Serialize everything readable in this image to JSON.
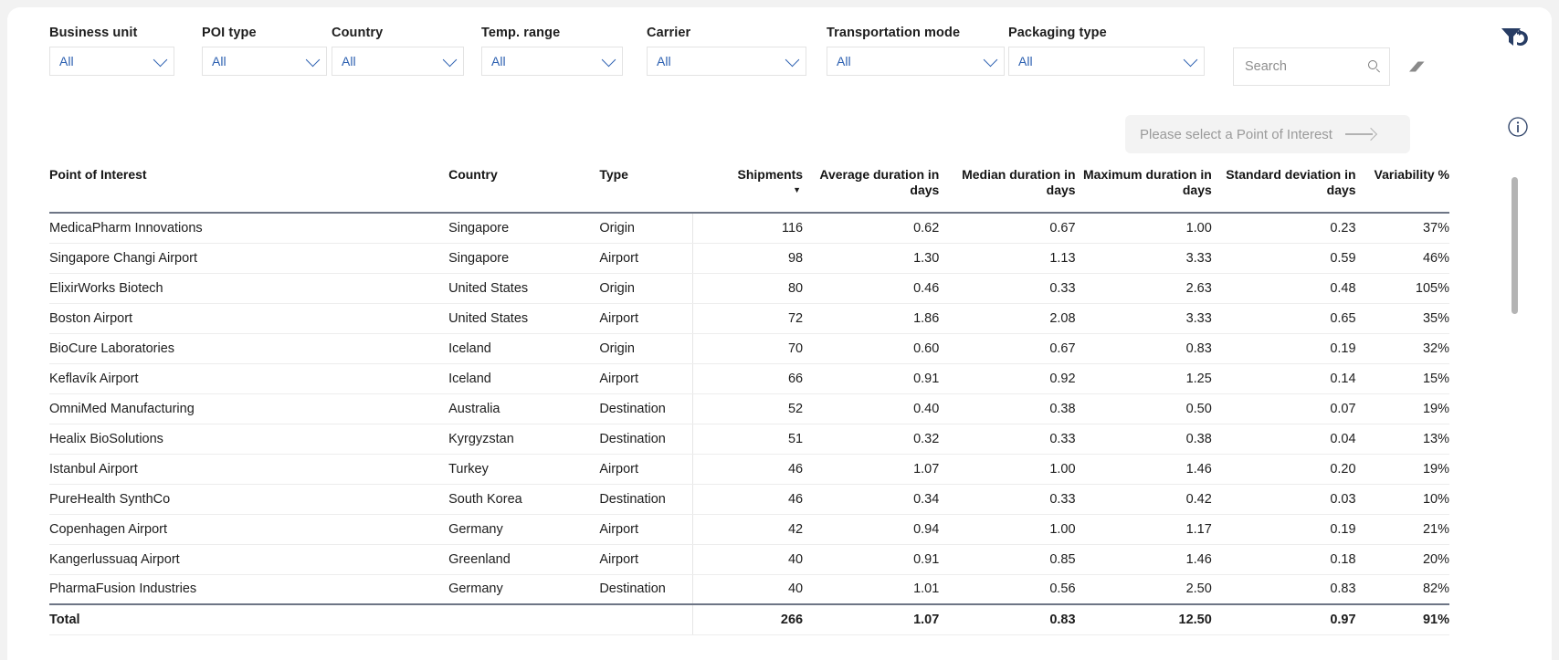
{
  "filters": [
    {
      "label": "Business unit",
      "value": "All",
      "name": "business-unit"
    },
    {
      "label": "POI type",
      "value": "All",
      "name": "poi-type"
    },
    {
      "label": "Country",
      "value": "All",
      "name": "country"
    },
    {
      "label": "Temp. range",
      "value": "All",
      "name": "temp-range"
    },
    {
      "label": "Carrier",
      "value": "All",
      "name": "carrier"
    },
    {
      "label": "Transportation mode",
      "value": "All",
      "name": "transportation-mode"
    },
    {
      "label": "Packaging type",
      "value": "All",
      "name": "packaging-type"
    }
  ],
  "search": {
    "value": "",
    "placeholder": "Search"
  },
  "poi_prompt": {
    "text": "Please select a Point of Interest"
  },
  "table": {
    "columns": [
      "Point of Interest",
      "Country",
      "Type",
      "Shipments",
      "Average duration in days",
      "Median duration in days",
      "Maximum duration in days",
      "Standard deviation in days",
      "Variability %"
    ],
    "sorted_column": "Shipments",
    "sort_direction": "desc",
    "sort_glyph": "▼",
    "rows": [
      {
        "poi": "MedicaPharm Innovations",
        "country": "Singapore",
        "type": "Origin",
        "shipments": "116",
        "avg": "0.62",
        "median": "0.67",
        "max": "1.00",
        "std": "0.23",
        "variability": "37%"
      },
      {
        "poi": "Singapore Changi Airport",
        "country": "Singapore",
        "type": "Airport",
        "shipments": "98",
        "avg": "1.30",
        "median": "1.13",
        "max": "3.33",
        "std": "0.59",
        "variability": "46%"
      },
      {
        "poi": "ElixirWorks Biotech",
        "country": "United States",
        "type": "Origin",
        "shipments": "80",
        "avg": "0.46",
        "median": "0.33",
        "max": "2.63",
        "std": "0.48",
        "variability": "105%"
      },
      {
        "poi": "Boston Airport",
        "country": "United States",
        "type": "Airport",
        "shipments": "72",
        "avg": "1.86",
        "median": "2.08",
        "max": "3.33",
        "std": "0.65",
        "variability": "35%"
      },
      {
        "poi": "BioCure Laboratories",
        "country": "Iceland",
        "type": "Origin",
        "shipments": "70",
        "avg": "0.60",
        "median": "0.67",
        "max": "0.83",
        "std": "0.19",
        "variability": "32%"
      },
      {
        "poi": "Keflavík Airport",
        "country": "Iceland",
        "type": "Airport",
        "shipments": "66",
        "avg": "0.91",
        "median": "0.92",
        "max": "1.25",
        "std": "0.14",
        "variability": "15%"
      },
      {
        "poi": "OmniMed Manufacturing",
        "country": "Australia",
        "type": "Destination",
        "shipments": "52",
        "avg": "0.40",
        "median": "0.38",
        "max": "0.50",
        "std": "0.07",
        "variability": "19%"
      },
      {
        "poi": "Healix BioSolutions",
        "country": "Kyrgyzstan",
        "type": "Destination",
        "shipments": "51",
        "avg": "0.32",
        "median": "0.33",
        "max": "0.38",
        "std": "0.04",
        "variability": "13%"
      },
      {
        "poi": "Istanbul Airport",
        "country": "Turkey",
        "type": "Airport",
        "shipments": "46",
        "avg": "1.07",
        "median": "1.00",
        "max": "1.46",
        "std": "0.20",
        "variability": "19%"
      },
      {
        "poi": "PureHealth SynthCo",
        "country": "South Korea",
        "type": "Destination",
        "shipments": "46",
        "avg": "0.34",
        "median": "0.33",
        "max": "0.42",
        "std": "0.03",
        "variability": "10%"
      },
      {
        "poi": "Copenhagen Airport",
        "country": "Germany",
        "type": "Airport",
        "shipments": "42",
        "avg": "0.94",
        "median": "1.00",
        "max": "1.17",
        "std": "0.19",
        "variability": "21%"
      },
      {
        "poi": "Kangerlussuaq Airport",
        "country": "Greenland",
        "type": "Airport",
        "shipments": "40",
        "avg": "0.91",
        "median": "0.85",
        "max": "1.46",
        "std": "0.18",
        "variability": "20%"
      },
      {
        "poi": "PharmaFusion Industries",
        "country": "Germany",
        "type": "Destination",
        "shipments": "40",
        "avg": "1.01",
        "median": "0.56",
        "max": "2.50",
        "std": "0.83",
        "variability": "82%"
      }
    ],
    "total": {
      "poi": "Total",
      "country": "",
      "type": "",
      "shipments": "266",
      "avg": "1.07",
      "median": "0.83",
      "max": "12.50",
      "std": "0.97",
      "variability": "91%"
    }
  },
  "colors": {
    "accent": "#2b5fb0",
    "brand": "#273c63",
    "rule": "#6d7585"
  }
}
